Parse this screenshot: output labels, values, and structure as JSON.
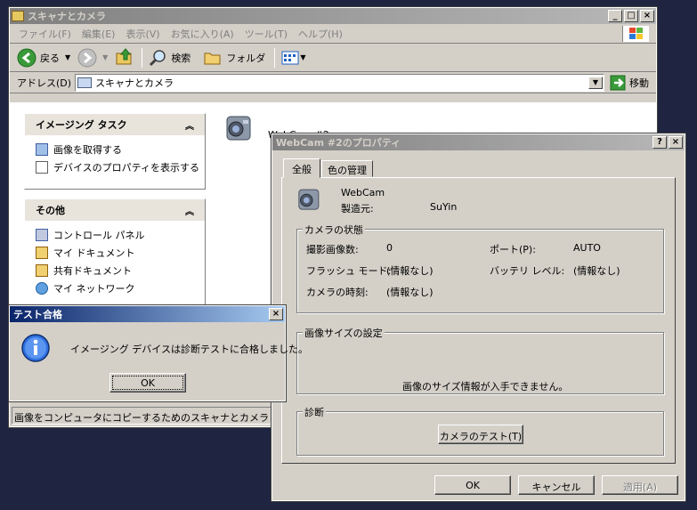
{
  "explorer": {
    "title": "スキャナとカメラ",
    "menu": [
      "ファイル(F)",
      "編集(E)",
      "表示(V)",
      "お気に入り(A)",
      "ツール(T)",
      "ヘルプ(H)"
    ],
    "toolbar": {
      "back": "戻る",
      "search": "検索",
      "folders": "フォルダ"
    },
    "address_label": "アドレス(D)",
    "address_value": "スキャナとカメラ",
    "go_label": "移動",
    "tasks": {
      "imaging_title": "イメージング タスク",
      "imaging_items": [
        "画像を取得する",
        "デバイスのプロパティを表示する"
      ],
      "other_title": "その他",
      "other_items": [
        "コントロール パネル",
        "マイ ドキュメント",
        "共有ドキュメント",
        "マイ ネットワーク"
      ]
    },
    "device_name": "WebCam #2",
    "status": "画像をコンピュータにコピーするためのスキャナとカメラ ウィザード"
  },
  "props": {
    "title": "WebCam #2のプロパティ",
    "tabs": [
      "全般",
      "色の管理"
    ],
    "device_label": "WebCam",
    "maker_label": "製造元:",
    "maker_value": "SuYin",
    "status_group": "カメラの状態",
    "shots_label": "撮影画像数:",
    "shots_value": "0",
    "port_label": "ポート(P):",
    "port_value": "AUTO",
    "flash_label": "フラッシュ モード:",
    "flash_value": "(情報なし)",
    "battery_label": "バッテリ レベル:",
    "battery_value": "(情報なし)",
    "clock_label": "カメラの時刻:",
    "clock_value": "(情報なし)",
    "size_group": "画像サイズの設定",
    "size_msg": "画像のサイズ情報が入手できません。",
    "diag_group": "診断",
    "test_button": "カメラのテスト(T)",
    "ok": "OK",
    "cancel": "キャンセル",
    "apply": "適用(A)"
  },
  "msgbox": {
    "title": "テスト合格",
    "message": "イメージング デバイスは診断テストに合格しました。",
    "ok": "OK"
  }
}
